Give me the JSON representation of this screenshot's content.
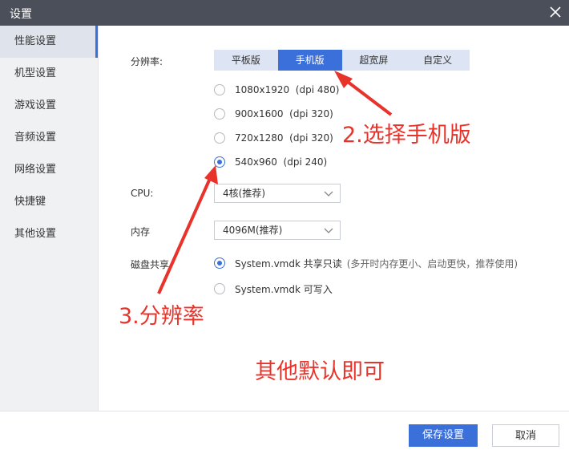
{
  "window": {
    "title": "设置"
  },
  "sidebar": {
    "items": [
      {
        "label": "性能设置",
        "active": true
      },
      {
        "label": "机型设置"
      },
      {
        "label": "游戏设置"
      },
      {
        "label": "音频设置"
      },
      {
        "label": "网络设置"
      },
      {
        "label": "快捷键"
      },
      {
        "label": "其他设置"
      }
    ]
  },
  "resolution": {
    "label": "分辨率:",
    "tabs": [
      "平板版",
      "手机版",
      "超宽屏",
      "自定义"
    ],
    "active_tab": "手机版",
    "options": [
      "1080x1920  (dpi 480)",
      "900x1600  (dpi 320)",
      "720x1280  (dpi 320)",
      "540x960  (dpi 240)"
    ],
    "selected_option": "540x960 (dpi 240)"
  },
  "cpu": {
    "label": "CPU:",
    "value": "4核(推荐)"
  },
  "memory": {
    "label": "内存",
    "value": "4096M(推荐)"
  },
  "disk": {
    "label": "磁盘共享",
    "options": [
      {
        "text": "System.vmdk 共享只读",
        "hint": "(多开时内存更小、启动更快，推荐使用)",
        "checked": true
      },
      {
        "text": "System.vmdk 可写入",
        "hint": "",
        "checked": false
      }
    ]
  },
  "annotations": {
    "step2": "2.选择手机版",
    "step3": "3.分辨率",
    "note": "其他默认即可",
    "color": "#e8332b"
  },
  "buttons": {
    "save": "保存设置",
    "cancel": "取消"
  },
  "colors": {
    "accent": "#3b6fd9",
    "titlebar": "#4a4f5a",
    "sidebar": "#f0f1f3"
  },
  "icons": {
    "close": "close-icon",
    "dropdown": "chevron-down-icon"
  }
}
